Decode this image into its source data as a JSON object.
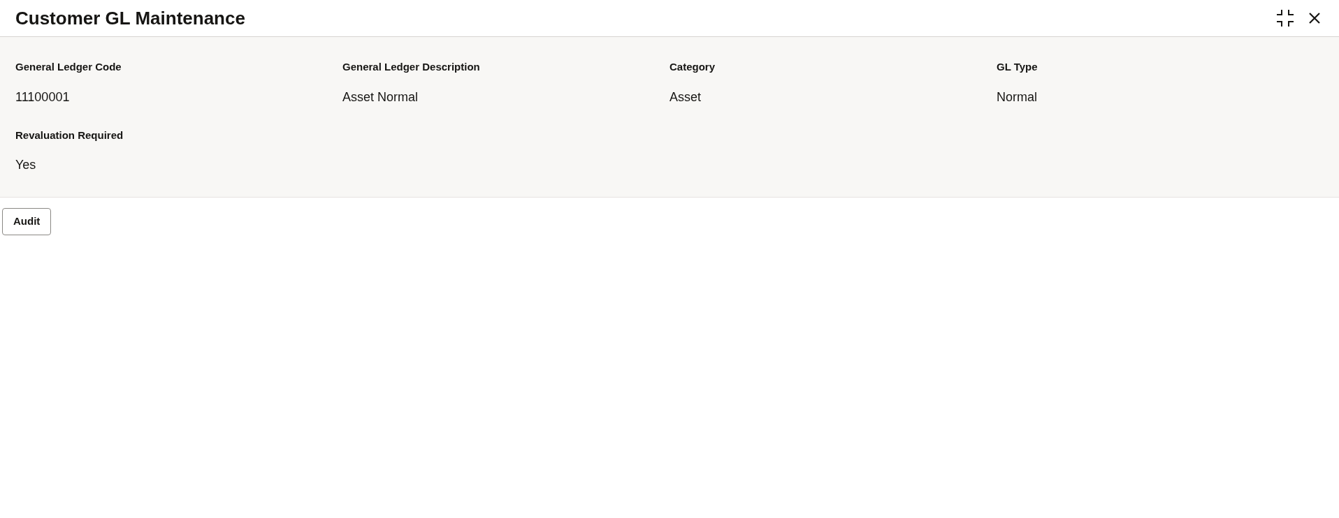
{
  "window": {
    "title": "Customer GL Maintenance"
  },
  "fields": [
    {
      "label": "General Ledger Code",
      "value": "11100001"
    },
    {
      "label": "General Ledger Description",
      "value": "Asset Normal"
    },
    {
      "label": "Category",
      "value": "Asset"
    },
    {
      "label": "GL Type",
      "value": "Normal"
    },
    {
      "label": "Revaluation Required",
      "value": "Yes"
    }
  ],
  "buttons": [
    "Audit"
  ]
}
